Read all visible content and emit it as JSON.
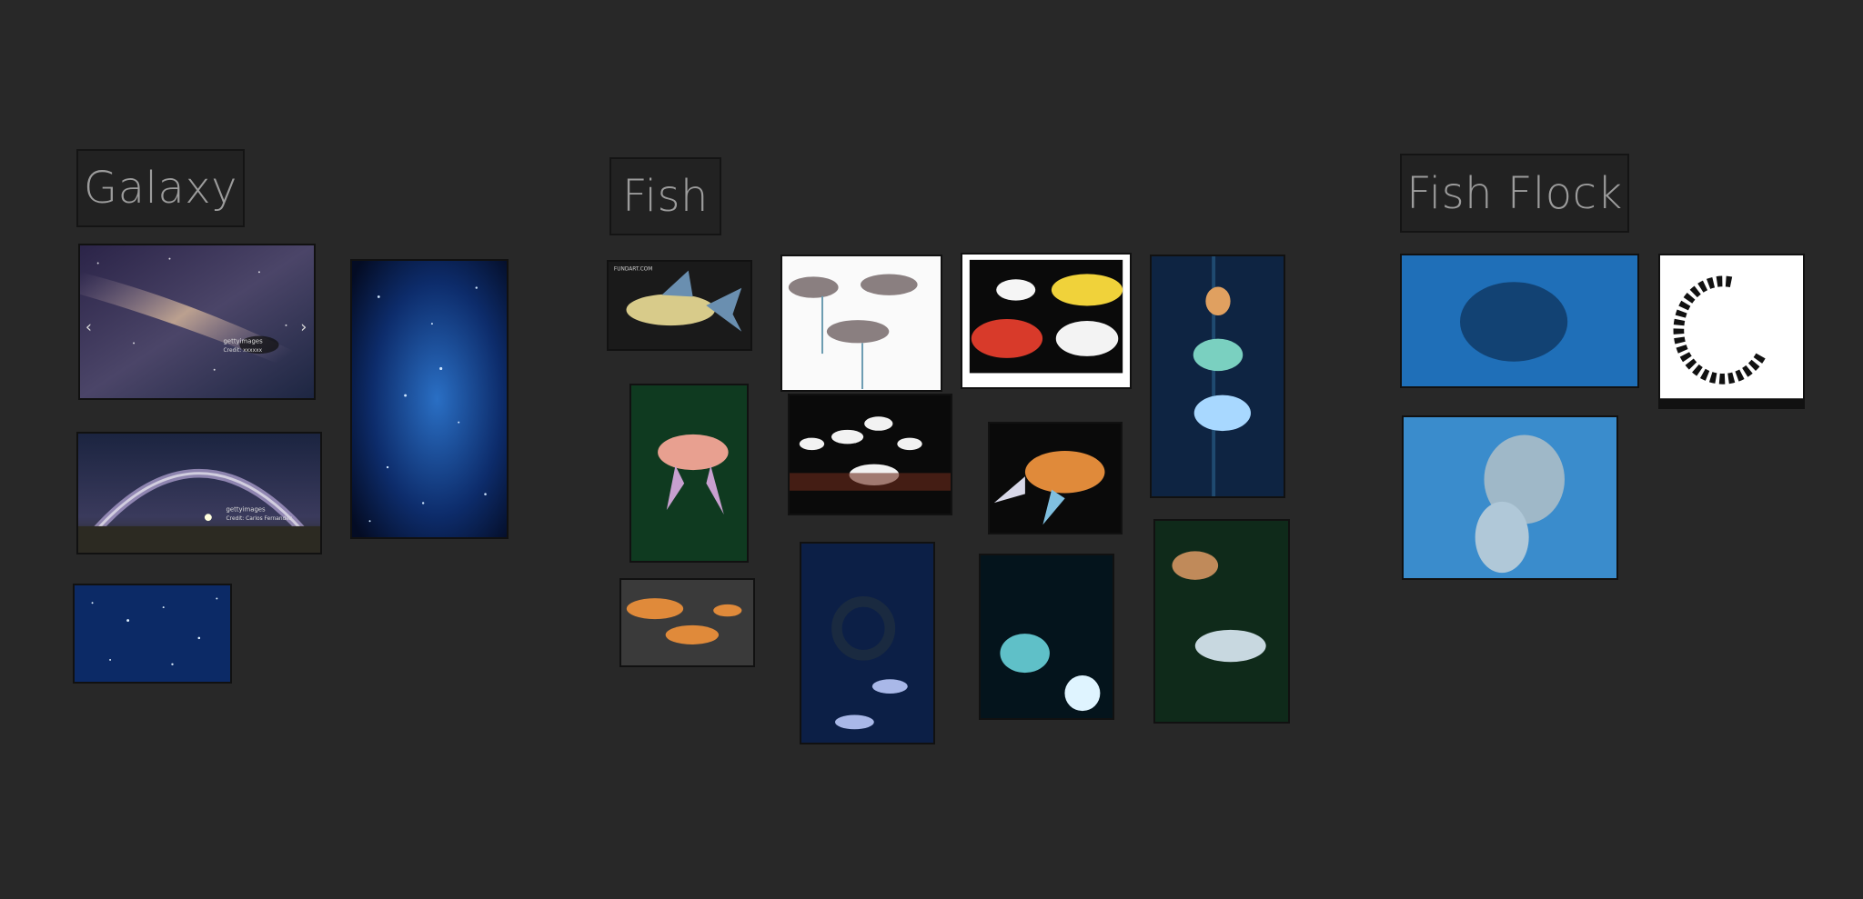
{
  "board": {
    "background": "#282828",
    "groups": [
      {
        "id": "galaxy",
        "label": "Galaxy"
      },
      {
        "id": "fish",
        "label": "Fish"
      },
      {
        "id": "fish-flock",
        "label": "Fish Flock"
      }
    ]
  },
  "galaxy": {
    "milky_way_1": {
      "watermark": "gettyimages",
      "credit": "Credit: xxxxxx",
      "nav_prev": "‹",
      "nav_next": "›"
    },
    "milky_way_2": {
      "watermark": "gettyimages",
      "credit": "Credit: Carlos Fernandez"
    }
  },
  "fish": {
    "koi_lantern_1": {
      "watermark": "FUNDART.COM"
    }
  },
  "colors": {
    "label_text": "#9c9c9c",
    "label_bg": "#222222",
    "night_blue": "#0b1a45",
    "lantern_orange": "#e08a3a",
    "ocean_blue": "#1f6fb8"
  }
}
